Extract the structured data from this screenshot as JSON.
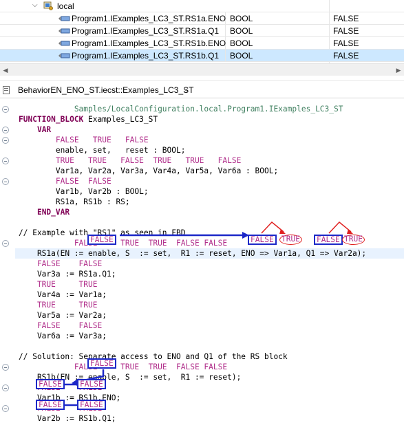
{
  "vartable": {
    "tree": {
      "node_label": "local"
    },
    "rows": [
      {
        "name": "Program1.IExamples_LC3_ST.RS1a.ENO",
        "type": "BOOL",
        "value": "FALSE"
      },
      {
        "name": "Program1.IExamples_LC3_ST.RS1a.Q1",
        "type": "BOOL",
        "value": "FALSE"
      },
      {
        "name": "Program1.IExamples_LC3_ST.RS1b.ENO",
        "type": "BOOL",
        "value": "FALSE"
      },
      {
        "name": "Program1.IExamples_LC3_ST.RS1b.Q1",
        "type": "BOOL",
        "value": "FALSE"
      }
    ],
    "selected_row": 3
  },
  "editor_tab": {
    "label": "BehaviorEN_ENO_ST.iecst::Examples_LC3_ST",
    "close": "×"
  },
  "code": {
    "lines": [
      "            Samples/LocalConfiguration.local.Program1.IExamples_LC3_ST",
      "FUNCTION_BLOCK Examples_LC3_ST",
      "    VAR",
      "        FALSE   TRUE   FALSE",
      "        enable, set,   reset : BOOL;",
      "        TRUE   TRUE   FALSE  TRUE   TRUE   FALSE",
      "        Var1a, Var2a, Var3a, Var4a, Var5a, Var6a : BOOL;",
      "        FALSE  FALSE",
      "        Var1b, Var2b : BOOL;",
      "        RS1a, RS1b : RS;",
      "    END_VAR",
      "",
      "// Example with \"RS1\" as seen in FBD",
      "            FALSE     TRUE  TRUE  FALSE FALSE",
      "    RS1a(EN := enable, S  := set,  R1 := reset, ENO => Var1a, Q1 => Var2a);",
      "    FALSE    FALSE",
      "    Var3a := RS1a.Q1;",
      "    TRUE     TRUE",
      "    Var4a := Var1a;",
      "    TRUE     TRUE",
      "    Var5a := Var2a;",
      "    FALSE    FALSE",
      "    Var6a := Var3a;",
      "",
      "// Solution: Separate access to ENO and Q1 of the RS block",
      "            FALSE     TRUE  TRUE  FALSE FALSE",
      "    RS1b(EN := enable, S  := set,  R1 := reset);",
      "    FALSE    FALSE",
      "    Var1b := RS1b.ENO;",
      "    FALSE    FALSE",
      "    Var2b := RS1b.Q1;"
    ]
  },
  "annotations": {
    "rs1a_en": "FALSE",
    "rs1a_eno_watch": "FALSE",
    "rs1a_eno_actual": "TRUE",
    "rs1a_q1_watch": "FALSE",
    "rs1a_q1_actual": "TRUE",
    "rs1b_en": "FALSE",
    "var1b_lhs": "FALSE",
    "var1b_rhs": "FALSE",
    "var2b_lhs": "FALSE",
    "var2b_rhs": "FALSE"
  },
  "colors": {
    "keyword": "#7f0055",
    "live_value": "#b02d8a",
    "path_text": "#3f7f5f",
    "annotation_box": "#1c28c8",
    "annotation_oval": "#e02020",
    "selection": "#cde8ff",
    "current_line": "#e8f2fe"
  },
  "icons": {
    "expand": "chevron-down-icon",
    "folder": "resource-folder-icon",
    "variable": "variable-icon",
    "file": "st-file-icon",
    "close": "close-icon",
    "fold": "fold-collapse-icon"
  }
}
